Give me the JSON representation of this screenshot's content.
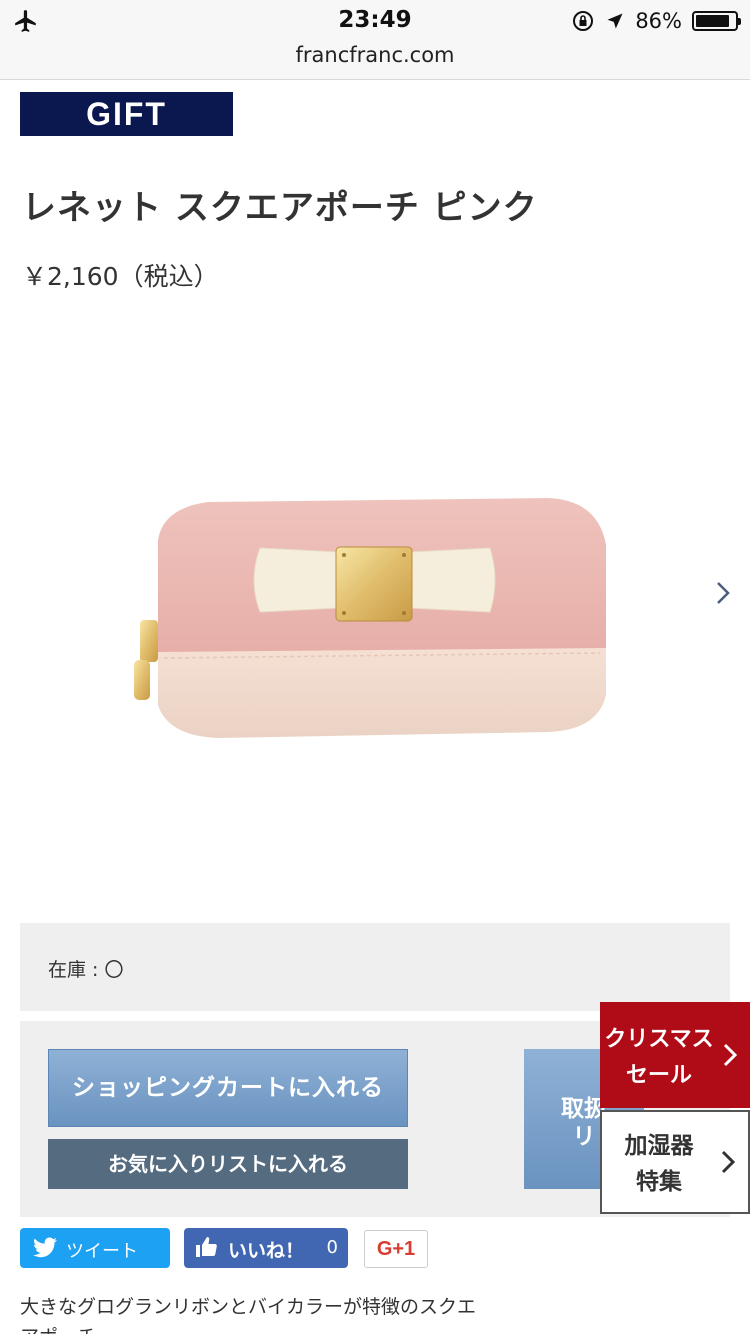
{
  "status_bar": {
    "time": "23:49",
    "battery_percent": "86%",
    "battery_level": 0.86,
    "icons": [
      "airplane-icon",
      "orientation-lock-icon",
      "location-arrow-icon",
      "battery-icon"
    ]
  },
  "browser": {
    "url": "francfranc.com"
  },
  "product": {
    "badge": "GIFT",
    "title": "レネット スクエアポーチ ピンク",
    "price": "￥2,160（税込）",
    "stock": "在庫 : 〇"
  },
  "actions": {
    "cart_label": "ショッピングカートに入れる",
    "favorite_label": "お気に入りリストに入れる",
    "store_label_line1": "取扱",
    "store_label_line2": "リ"
  },
  "side_banners": {
    "sale_line1": "クリスマス",
    "sale_line2": "セール",
    "humidifier_line1": "加湿器",
    "humidifier_line2": "特集"
  },
  "social": {
    "tweet_label": "ツイート",
    "like_label": "いいね！",
    "like_count": "0",
    "gplus_label": "G+1"
  },
  "description_text": "大きなグログランリボンとバイカラーが特徴のスクエアポーチ",
  "colors": {
    "badge_bg": "#0b174f",
    "sale_red": "#b00c17",
    "button_blue": "#7aa1cb",
    "twitter": "#1da1f2",
    "facebook": "#4267b2"
  }
}
